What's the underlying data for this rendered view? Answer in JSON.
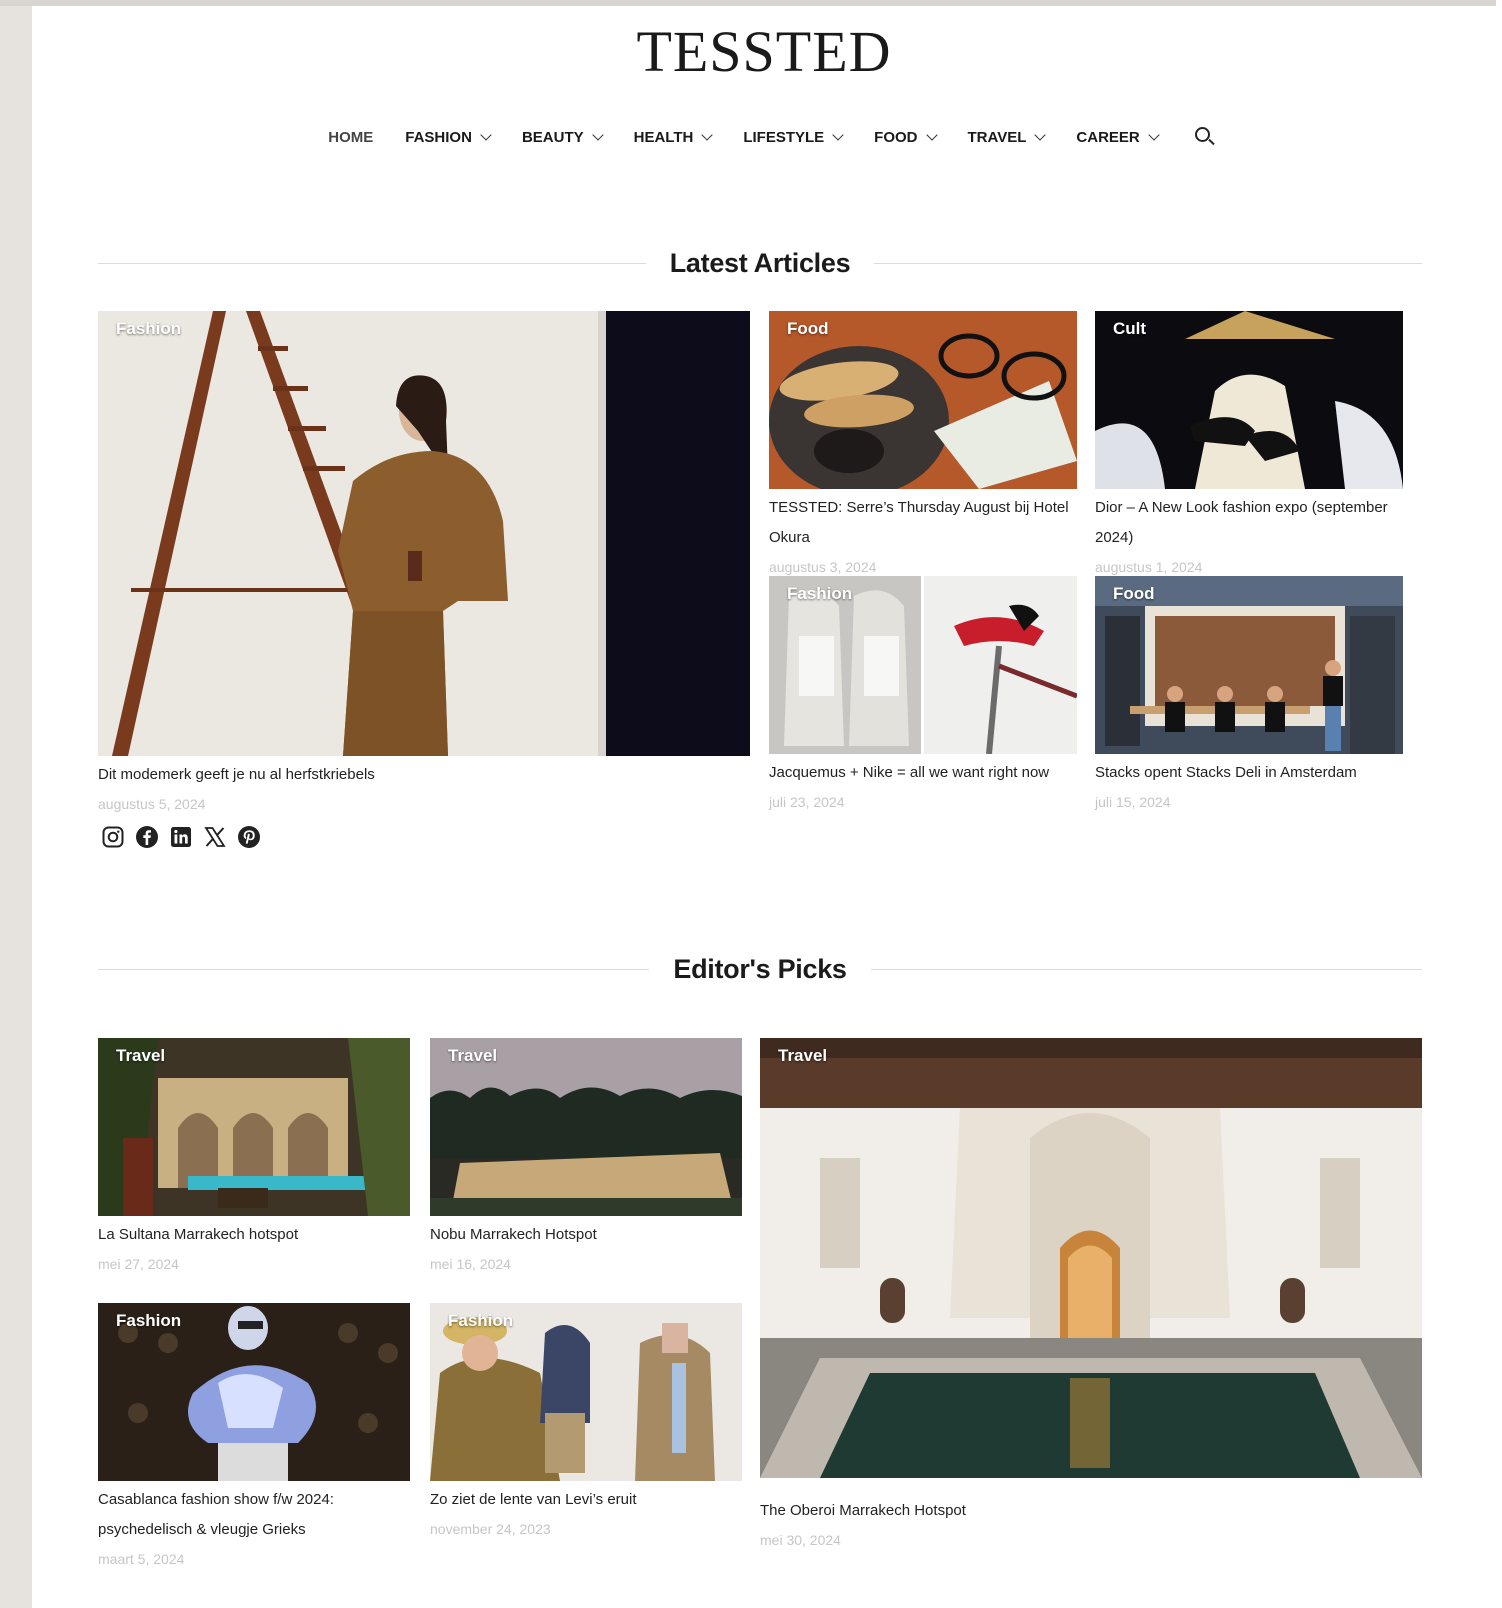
{
  "site": {
    "logo": "TESSTED"
  },
  "nav": {
    "items": [
      {
        "label": "HOME",
        "dropdown": false,
        "active": true
      },
      {
        "label": "FASHION",
        "dropdown": true
      },
      {
        "label": "BEAUTY",
        "dropdown": true
      },
      {
        "label": "HEALTH",
        "dropdown": true
      },
      {
        "label": "LIFESTYLE",
        "dropdown": true
      },
      {
        "label": "FOOD",
        "dropdown": true
      },
      {
        "label": "TRAVEL",
        "dropdown": true
      },
      {
        "label": "CAREER",
        "dropdown": true
      }
    ],
    "search_icon": "search-icon"
  },
  "latest": {
    "heading": "Latest Articles",
    "featured": {
      "category": "Fashion",
      "title": "Dit modemerk geeft je nu al herfstkriebels",
      "date": "augustus 5, 2024"
    },
    "items": [
      {
        "category": "Food",
        "title": "TESSTED: Serre’s Thursday August bij Hotel Okura",
        "date": "augustus 3, 2024"
      },
      {
        "category": "Cult",
        "title": "Dior – A New Look fashion expo (september 2024)",
        "date": "augustus 1, 2024"
      },
      {
        "category": "Fashion",
        "title": "Jacquemus + Nike = all we want right now",
        "date": "juli 23, 2024"
      },
      {
        "category": "Food",
        "title": "Stacks opent Stacks Deli in Amsterdam",
        "date": "juli 15, 2024"
      }
    ]
  },
  "social": [
    "instagram-icon",
    "facebook-icon",
    "linkedin-icon",
    "x-icon",
    "pinterest-icon"
  ],
  "picks": {
    "heading": "Editor's Picks",
    "items": [
      {
        "category": "Travel",
        "title": "La Sultana Marrakech hotspot",
        "date": "mei 27, 2024"
      },
      {
        "category": "Travel",
        "title": "Nobu Marrakech Hotspot",
        "date": "mei 16, 2024"
      },
      {
        "category": "Fashion",
        "title": "Casablanca fashion show f/w 2024: psychedelisch & vleugje Grieks",
        "date": "maart 5, 2024"
      },
      {
        "category": "Fashion",
        "title": "Zo ziet de lente van Levi’s eruit",
        "date": "november 24, 2023"
      }
    ],
    "featured": {
      "category": "Travel",
      "title": "The Oberoi Marrakech Hotspot",
      "date": "mei 30, 2024"
    }
  },
  "colors": {
    "page_bg": "#ffffff",
    "outer_bg": "#e6e3df",
    "date_gray": "#c6c6c6",
    "rule_gray": "#dcdcdc"
  }
}
